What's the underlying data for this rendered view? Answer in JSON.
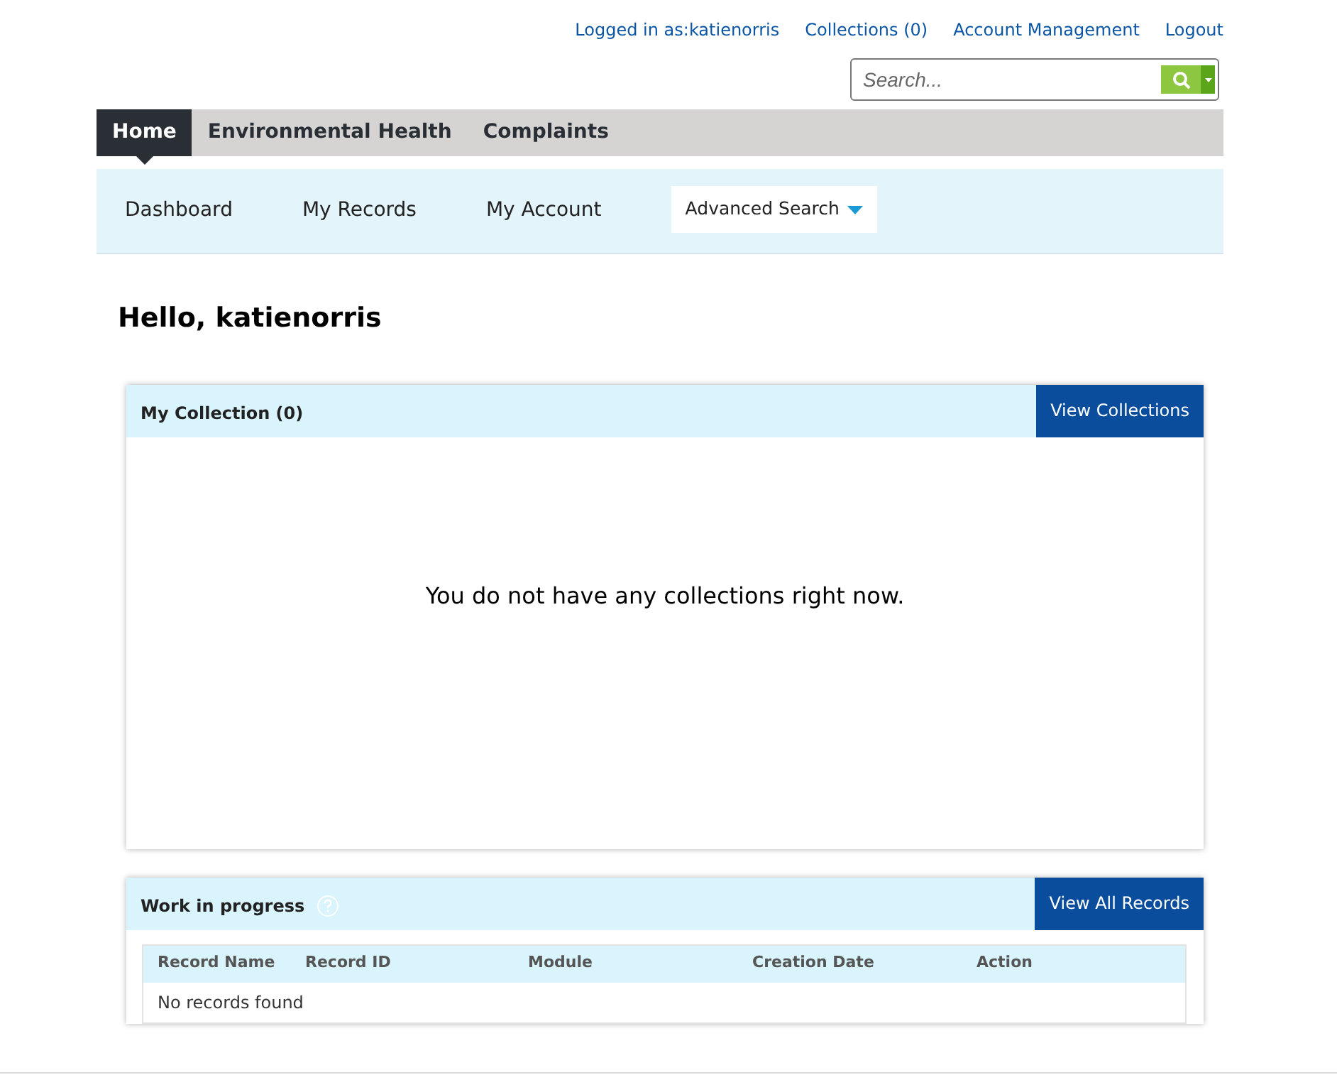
{
  "top_links": [
    {
      "label": "Logged in as:katienorris"
    },
    {
      "label": "Collections (0)"
    },
    {
      "label": "Account Management"
    },
    {
      "label": "Logout"
    }
  ],
  "search": {
    "placeholder": "Search..."
  },
  "main_tabs": [
    {
      "label": "Home",
      "selected": true
    },
    {
      "label": "Environmental Health",
      "selected": false
    },
    {
      "label": "Complaints",
      "selected": false
    }
  ],
  "sub_nav": [
    {
      "label": "Dashboard",
      "kind": "link"
    },
    {
      "label": "My Records",
      "kind": "link"
    },
    {
      "label": "My Account",
      "kind": "link"
    },
    {
      "label": "Advanced Search",
      "kind": "dropdown"
    }
  ],
  "greeting": "Hello, katienorris",
  "collection_panel": {
    "title": "My Collection (0)",
    "button": "View Collections",
    "message": "You do not have any collections right now."
  },
  "work_panel": {
    "title": "Work in progress",
    "button": "View All Records",
    "columns": [
      "Record Name",
      "Record ID",
      "Module",
      "Creation Date",
      "Action"
    ],
    "empty": "No records found"
  }
}
